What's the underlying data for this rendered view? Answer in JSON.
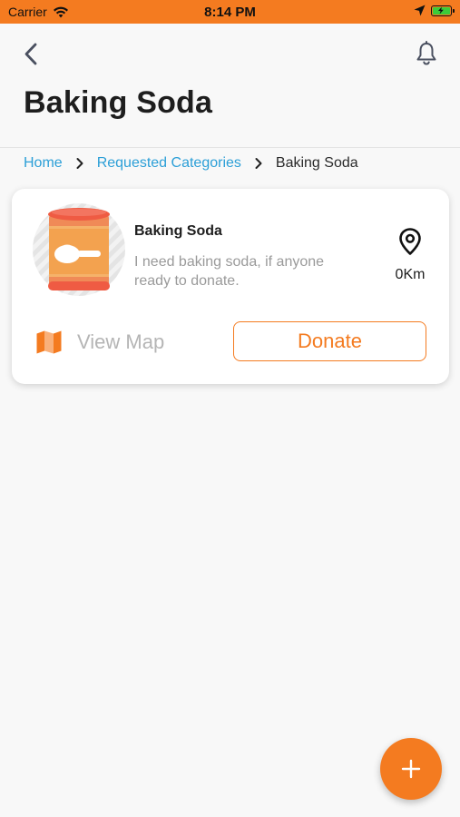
{
  "status_bar": {
    "carrier": "Carrier",
    "time": "8:14 PM",
    "battery_level": 1.0
  },
  "header": {
    "title": "Baking Soda",
    "back_icon": "chevron-left-icon",
    "notification_icon": "bell-icon"
  },
  "breadcrumb": {
    "items": [
      {
        "label": "Home"
      },
      {
        "label": "Requested Categories"
      },
      {
        "label": "Baking Soda"
      }
    ],
    "separator_icon": "chevron-right-icon"
  },
  "request_card": {
    "image_icon": "baking-soda-can-icon",
    "name": "Baking Soda",
    "description": "I need baking soda, if anyone ready to donate.",
    "location_icon": "map-pin-icon",
    "distance": "0Km",
    "view_map_label": "View Map",
    "map_icon": "folded-map-icon",
    "donate_label": "Donate"
  },
  "fab": {
    "icon": "plus-icon"
  },
  "colors": {
    "accent": "#f47b20",
    "link": "#2c9fd7",
    "status_bar": "#f47b20",
    "background": "#f8f8f8"
  }
}
